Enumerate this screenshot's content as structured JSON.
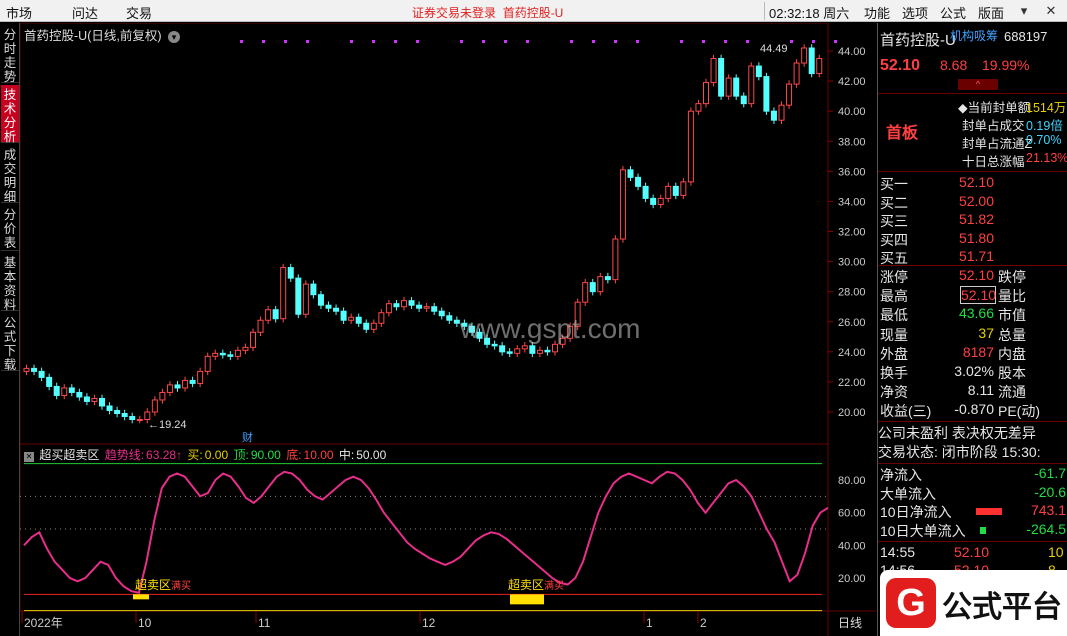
{
  "menubar": {
    "items": [
      "市场",
      "问达",
      "交易"
    ],
    "notice_left": "证券交易未登录",
    "notice_right": "首药控股-U",
    "clock": "02:32:18 周六",
    "right_items": [
      "功能",
      "选项",
      "公式",
      "版面"
    ]
  },
  "sidebar": {
    "tabs": [
      "分时走势",
      "技术分析",
      "成交明细",
      "分价表",
      "基本资料",
      "公式下载"
    ]
  },
  "chart": {
    "title": "首药控股-U(日线,前复权)",
    "price_ticks": [
      "44.00",
      "42.00",
      "40.00",
      "38.00",
      "36.00",
      "34.00",
      "32.00",
      "30.00",
      "28.00",
      "26.00",
      "24.00",
      "22.00",
      "20.00"
    ],
    "high_label": "44.49",
    "low_label": "19.24",
    "finance_badge": "财",
    "indicator": {
      "name": "超买超卖区",
      "trend_label": "趋势线:",
      "trend_value": "63.28↑",
      "buy_label": "买:",
      "buy_value": "0.00",
      "top_label": "顶:",
      "top_value": "90.00",
      "bottom_label": "底:",
      "bottom_value": "10.00",
      "mid_label": "中:",
      "mid_value": "50.00",
      "ticks": [
        "80.00",
        "60.00",
        "40.00",
        "20.00"
      ],
      "oversold_label": "超卖区",
      "buy_mark": "满买"
    },
    "x_labels": [
      "2022年",
      "10",
      "11",
      "12",
      "1",
      "2"
    ],
    "period_label": "日线",
    "watermark": "www.gspt.com"
  },
  "panel": {
    "name": "首药控股-U",
    "tag": "机构吸筹",
    "code": "688197",
    "price": "52.10",
    "change": "8.68",
    "pct": "19.99%",
    "board_label": "首板",
    "seal_rows": [
      {
        "label": "当前封单额",
        "value": "1514万"
      },
      {
        "label": "封单占成交",
        "value": "0.19倍"
      },
      {
        "label": "封单占流通Z",
        "value": "0.70%"
      },
      {
        "label": "十日总涨幅",
        "value": "21.13%"
      }
    ],
    "bids": [
      {
        "label": "买一",
        "price": "52.10"
      },
      {
        "label": "买二",
        "price": "52.00"
      },
      {
        "label": "买三",
        "price": "51.82"
      },
      {
        "label": "买四",
        "price": "51.80"
      },
      {
        "label": "买五",
        "price": "51.71"
      }
    ],
    "stats": [
      {
        "label": "涨停",
        "value": "52.10",
        "label2": "跌停"
      },
      {
        "label": "最高",
        "value": "52.10",
        "label2": "量比"
      },
      {
        "label": "最低",
        "value": "43.66",
        "label2": "市值"
      },
      {
        "label": "现量",
        "value": "37",
        "label2": "总量"
      },
      {
        "label": "外盘",
        "value": "8187",
        "label2": "内盘"
      },
      {
        "label": "换手",
        "value": "3.02%",
        "label2": "股本"
      },
      {
        "label": "净资",
        "value": "8.11",
        "label2": "流通"
      },
      {
        "label": "收益(三)",
        "value": "-0.870",
        "label2": "PE(动)"
      }
    ],
    "notice_line": "公司未盈利 表决权无差异",
    "trade_status": "交易状态: 闭市阶段 15:30:",
    "flows": [
      {
        "label": "净流入",
        "value": "-61.7"
      },
      {
        "label": "大单流入",
        "value": "-20.6"
      },
      {
        "label": "10日净流入",
        "value": "743.1"
      },
      {
        "label": "10日大单流入",
        "value": "-264.5"
      }
    ],
    "ticks": [
      {
        "time": "14:55",
        "price": "52.10",
        "vol": "10"
      },
      {
        "time": "14:56",
        "price": "52.10",
        "vol": "8"
      }
    ]
  },
  "logo": {
    "text": "公式平台"
  }
}
